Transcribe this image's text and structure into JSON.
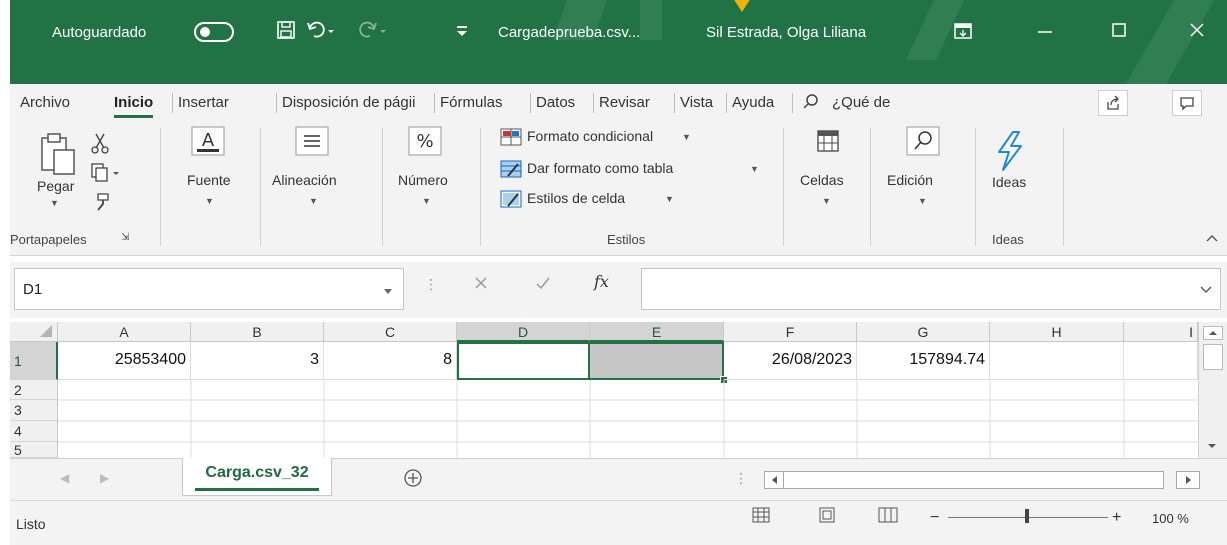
{
  "titlebar": {
    "autosave_label": "Autoguardado",
    "filename": "Cargadeprueba.csv...",
    "user": "Sil Estrada, Olga Liliana",
    "bg_color": "#217346"
  },
  "tabs": [
    {
      "label": "Archivo"
    },
    {
      "label": "Inicio"
    },
    {
      "label": "Insertar"
    },
    {
      "label": "Disposición de págii"
    },
    {
      "label": "Fórmulas"
    },
    {
      "label": "Datos"
    },
    {
      "label": "Revisar"
    },
    {
      "label": "Vista"
    },
    {
      "label": "Ayuda"
    }
  ],
  "tell_me": "¿Qué de",
  "ribbon": {
    "paste": "Pegar",
    "clipboard_group": "Portapapeles",
    "font": "Fuente",
    "alignment": "Alineación",
    "number": "Número",
    "cond_format": "Formato condicional",
    "format_table": "Dar formato como tabla",
    "cell_styles": "Estilos de celda",
    "styles_group": "Estilos",
    "cells": "Celdas",
    "editing": "Edición",
    "ideas": "Ideas",
    "ideas_group": "Ideas"
  },
  "namebox": "D1",
  "formula_value": "",
  "fx_symbol": "fx",
  "columns": [
    "A",
    "B",
    "C",
    "D",
    "E",
    "F",
    "G",
    "H",
    "I"
  ],
  "rows": [
    "1",
    "2",
    "3",
    "4",
    "5"
  ],
  "row1": [
    "25853400",
    "3",
    "8",
    "",
    "",
    "26/08/2023",
    "157894.74",
    "",
    ""
  ],
  "sheet_tab": "Carga.csv_32",
  "status": {
    "ready": "Listo",
    "zoom": "100 %"
  }
}
